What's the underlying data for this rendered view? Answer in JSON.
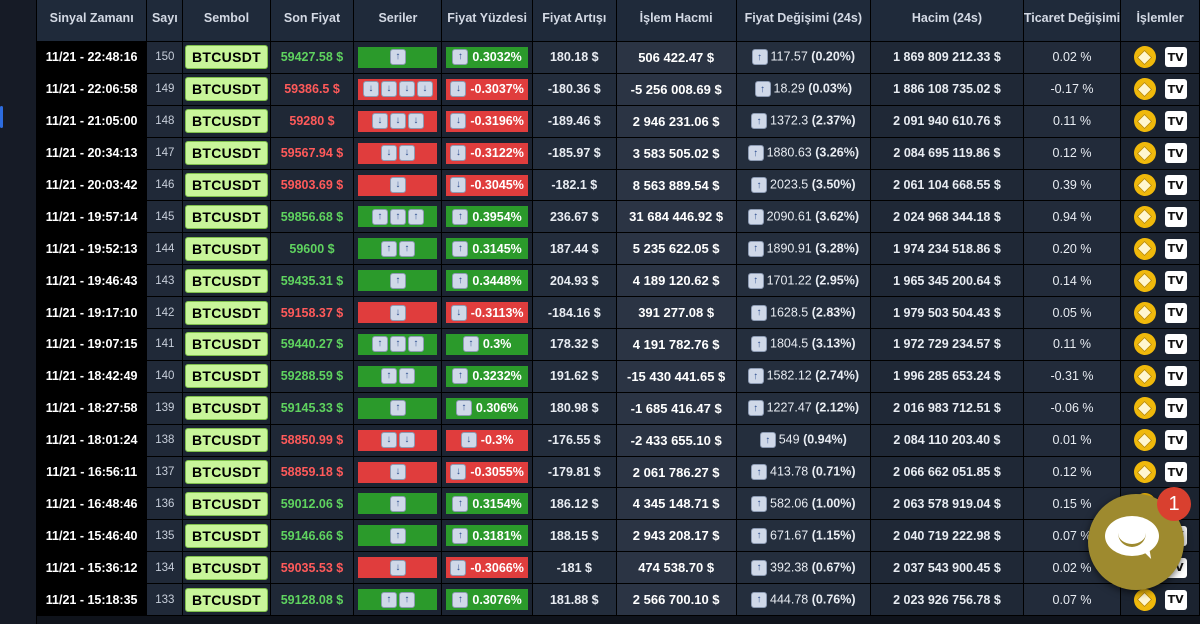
{
  "columns": [
    "Sinyal Zamanı",
    "Sayı",
    "Sembol",
    "Son Fiyat",
    "Seriler",
    "Fiyat Yüzdesi",
    "Fiyat Artışı",
    "İşlem Hacmi",
    "Fiyat Değişimi (24s)",
    "Hacim (24s)",
    "Ticaret Değişimi",
    "İşlemler"
  ],
  "colors": {
    "up": "#5fd35f",
    "down": "#ff5a5a",
    "green_bar": "#2b9a2b",
    "red_bar": "#e03d3d",
    "symbol_bg": "#c8f59a"
  },
  "icons": [
    "arrow-up-icon",
    "arrow-down-icon",
    "binance-icon",
    "tradingview-icon",
    "chat-icon"
  ],
  "rows": [
    {
      "time": "11/21 - 22:48:16",
      "idx": "150",
      "symbol": "BTCUSDT",
      "price": "59427.58 $",
      "dir": "up",
      "series": 1,
      "pct": "0.3032%",
      "inc": "180.18 $",
      "vol": "506 422.47 $",
      "chg": "117.57",
      "chg_pct": "(0.20%)",
      "vol24": "1 869 809 212.33 $",
      "trade": "0.02 %"
    },
    {
      "time": "11/21 - 22:06:58",
      "idx": "149",
      "symbol": "BTCUSDT",
      "price": "59386.5 $",
      "dir": "down",
      "series": 4,
      "pct": "-0.3037%",
      "inc": "-180.36 $",
      "vol": "-5 256 008.69 $",
      "chg": "18.29",
      "chg_pct": "(0.03%)",
      "vol24": "1 886 108 735.02 $",
      "trade": "-0.17 %"
    },
    {
      "time": "11/21 - 21:05:00",
      "idx": "148",
      "symbol": "BTCUSDT",
      "price": "59280 $",
      "dir": "down",
      "series": 3,
      "pct": "-0.3196%",
      "inc": "-189.46 $",
      "vol": "2 946 231.06 $",
      "chg": "1372.3",
      "chg_pct": "(2.37%)",
      "vol24": "2 091 940 610.76 $",
      "trade": "0.11 %"
    },
    {
      "time": "11/21 - 20:34:13",
      "idx": "147",
      "symbol": "BTCUSDT",
      "price": "59567.94 $",
      "dir": "down",
      "series": 2,
      "pct": "-0.3122%",
      "inc": "-185.97 $",
      "vol": "3 583 505.02 $",
      "chg": "1880.63",
      "chg_pct": "(3.26%)",
      "vol24": "2 084 695 119.86 $",
      "trade": "0.12 %"
    },
    {
      "time": "11/21 - 20:03:42",
      "idx": "146",
      "symbol": "BTCUSDT",
      "price": "59803.69 $",
      "dir": "down",
      "series": 1,
      "pct": "-0.3045%",
      "inc": "-182.1 $",
      "vol": "8 563 889.54 $",
      "chg": "2023.5",
      "chg_pct": "(3.50%)",
      "vol24": "2 061 104 668.55 $",
      "trade": "0.39 %"
    },
    {
      "time": "11/21 - 19:57:14",
      "idx": "145",
      "symbol": "BTCUSDT",
      "price": "59856.68 $",
      "dir": "up",
      "series": 3,
      "pct": "0.3954%",
      "inc": "236.67 $",
      "vol": "31 684 446.92 $",
      "chg": "2090.61",
      "chg_pct": "(3.62%)",
      "vol24": "2 024 968 344.18 $",
      "trade": "0.94 %"
    },
    {
      "time": "11/21 - 19:52:13",
      "idx": "144",
      "symbol": "BTCUSDT",
      "price": "59600 $",
      "dir": "up",
      "series": 2,
      "pct": "0.3145%",
      "inc": "187.44 $",
      "vol": "5 235 622.05 $",
      "chg": "1890.91",
      "chg_pct": "(3.28%)",
      "vol24": "1 974 234 518.86 $",
      "trade": "0.20 %"
    },
    {
      "time": "11/21 - 19:46:43",
      "idx": "143",
      "symbol": "BTCUSDT",
      "price": "59435.31 $",
      "dir": "up",
      "series": 1,
      "pct": "0.3448%",
      "inc": "204.93 $",
      "vol": "4 189 120.62 $",
      "chg": "1701.22",
      "chg_pct": "(2.95%)",
      "vol24": "1 965 345 200.64 $",
      "trade": "0.14 %"
    },
    {
      "time": "11/21 - 19:17:10",
      "idx": "142",
      "symbol": "BTCUSDT",
      "price": "59158.37 $",
      "dir": "down",
      "series": 1,
      "pct": "-0.3113%",
      "inc": "-184.16 $",
      "vol": "391 277.08 $",
      "chg": "1628.5",
      "chg_pct": "(2.83%)",
      "vol24": "1 979 503 504.43 $",
      "trade": "0.05 %"
    },
    {
      "time": "11/21 - 19:07:15",
      "idx": "141",
      "symbol": "BTCUSDT",
      "price": "59440.27 $",
      "dir": "up",
      "series": 3,
      "pct": "0.3%",
      "inc": "178.32 $",
      "vol": "4 191 782.76 $",
      "chg": "1804.5",
      "chg_pct": "(3.13%)",
      "vol24": "1 972 729 234.57 $",
      "trade": "0.11 %"
    },
    {
      "time": "11/21 - 18:42:49",
      "idx": "140",
      "symbol": "BTCUSDT",
      "price": "59288.59 $",
      "dir": "up",
      "series": 2,
      "pct": "0.3232%",
      "inc": "191.62 $",
      "vol": "-15 430 441.65 $",
      "chg": "1582.12",
      "chg_pct": "(2.74%)",
      "vol24": "1 996 285 653.24 $",
      "trade": "-0.31 %"
    },
    {
      "time": "11/21 - 18:27:58",
      "idx": "139",
      "symbol": "BTCUSDT",
      "price": "59145.33 $",
      "dir": "up",
      "series": 1,
      "pct": "0.306%",
      "inc": "180.98 $",
      "vol": "-1 685 416.47 $",
      "chg": "1227.47",
      "chg_pct": "(2.12%)",
      "vol24": "2 016 983 712.51 $",
      "trade": "-0.06 %"
    },
    {
      "time": "11/21 - 18:01:24",
      "idx": "138",
      "symbol": "BTCUSDT",
      "price": "58850.99 $",
      "dir": "down",
      "series": 2,
      "pct": "-0.3%",
      "inc": "-176.55 $",
      "vol": "-2 433 655.10 $",
      "chg": "549",
      "chg_pct": "(0.94%)",
      "vol24": "2 084 110 203.40 $",
      "trade": "0.01 %"
    },
    {
      "time": "11/21 - 16:56:11",
      "idx": "137",
      "symbol": "BTCUSDT",
      "price": "58859.18 $",
      "dir": "down",
      "series": 1,
      "pct": "-0.3055%",
      "inc": "-179.81 $",
      "vol": "2 061 786.27 $",
      "chg": "413.78",
      "chg_pct": "(0.71%)",
      "vol24": "2 066 662 051.85 $",
      "trade": "0.12 %"
    },
    {
      "time": "11/21 - 16:48:46",
      "idx": "136",
      "symbol": "BTCUSDT",
      "price": "59012.06 $",
      "dir": "up",
      "series": 1,
      "pct": "0.3154%",
      "inc": "186.12 $",
      "vol": "4 345 148.71 $",
      "chg": "582.06",
      "chg_pct": "(1.00%)",
      "vol24": "2 063 578 919.04 $",
      "trade": "0.15 %"
    },
    {
      "time": "11/21 - 15:46:40",
      "idx": "135",
      "symbol": "BTCUSDT",
      "price": "59146.66 $",
      "dir": "up",
      "series": 1,
      "pct": "0.3181%",
      "inc": "188.15 $",
      "vol": "2 943 208.17 $",
      "chg": "671.67",
      "chg_pct": "(1.15%)",
      "vol24": "2 040 719 222.98 $",
      "trade": "0.07 %"
    },
    {
      "time": "11/21 - 15:36:12",
      "idx": "134",
      "symbol": "BTCUSDT",
      "price": "59035.53 $",
      "dir": "down",
      "series": 1,
      "pct": "-0.3066%",
      "inc": "-181 $",
      "vol": "474 538.70 $",
      "chg": "392.38",
      "chg_pct": "(0.67%)",
      "vol24": "2 037 543 900.45 $",
      "trade": "0.02 %"
    },
    {
      "time": "11/21 - 15:18:35",
      "idx": "133",
      "symbol": "BTCUSDT",
      "price": "59128.08 $",
      "dir": "up",
      "series": 2,
      "pct": "0.3076%",
      "inc": "181.88 $",
      "vol": "2 566 700.10 $",
      "chg": "444.78",
      "chg_pct": "(0.76%)",
      "vol24": "2 023 926 756.78 $",
      "trade": "0.07 %"
    }
  ],
  "chat": {
    "badge": "1"
  }
}
